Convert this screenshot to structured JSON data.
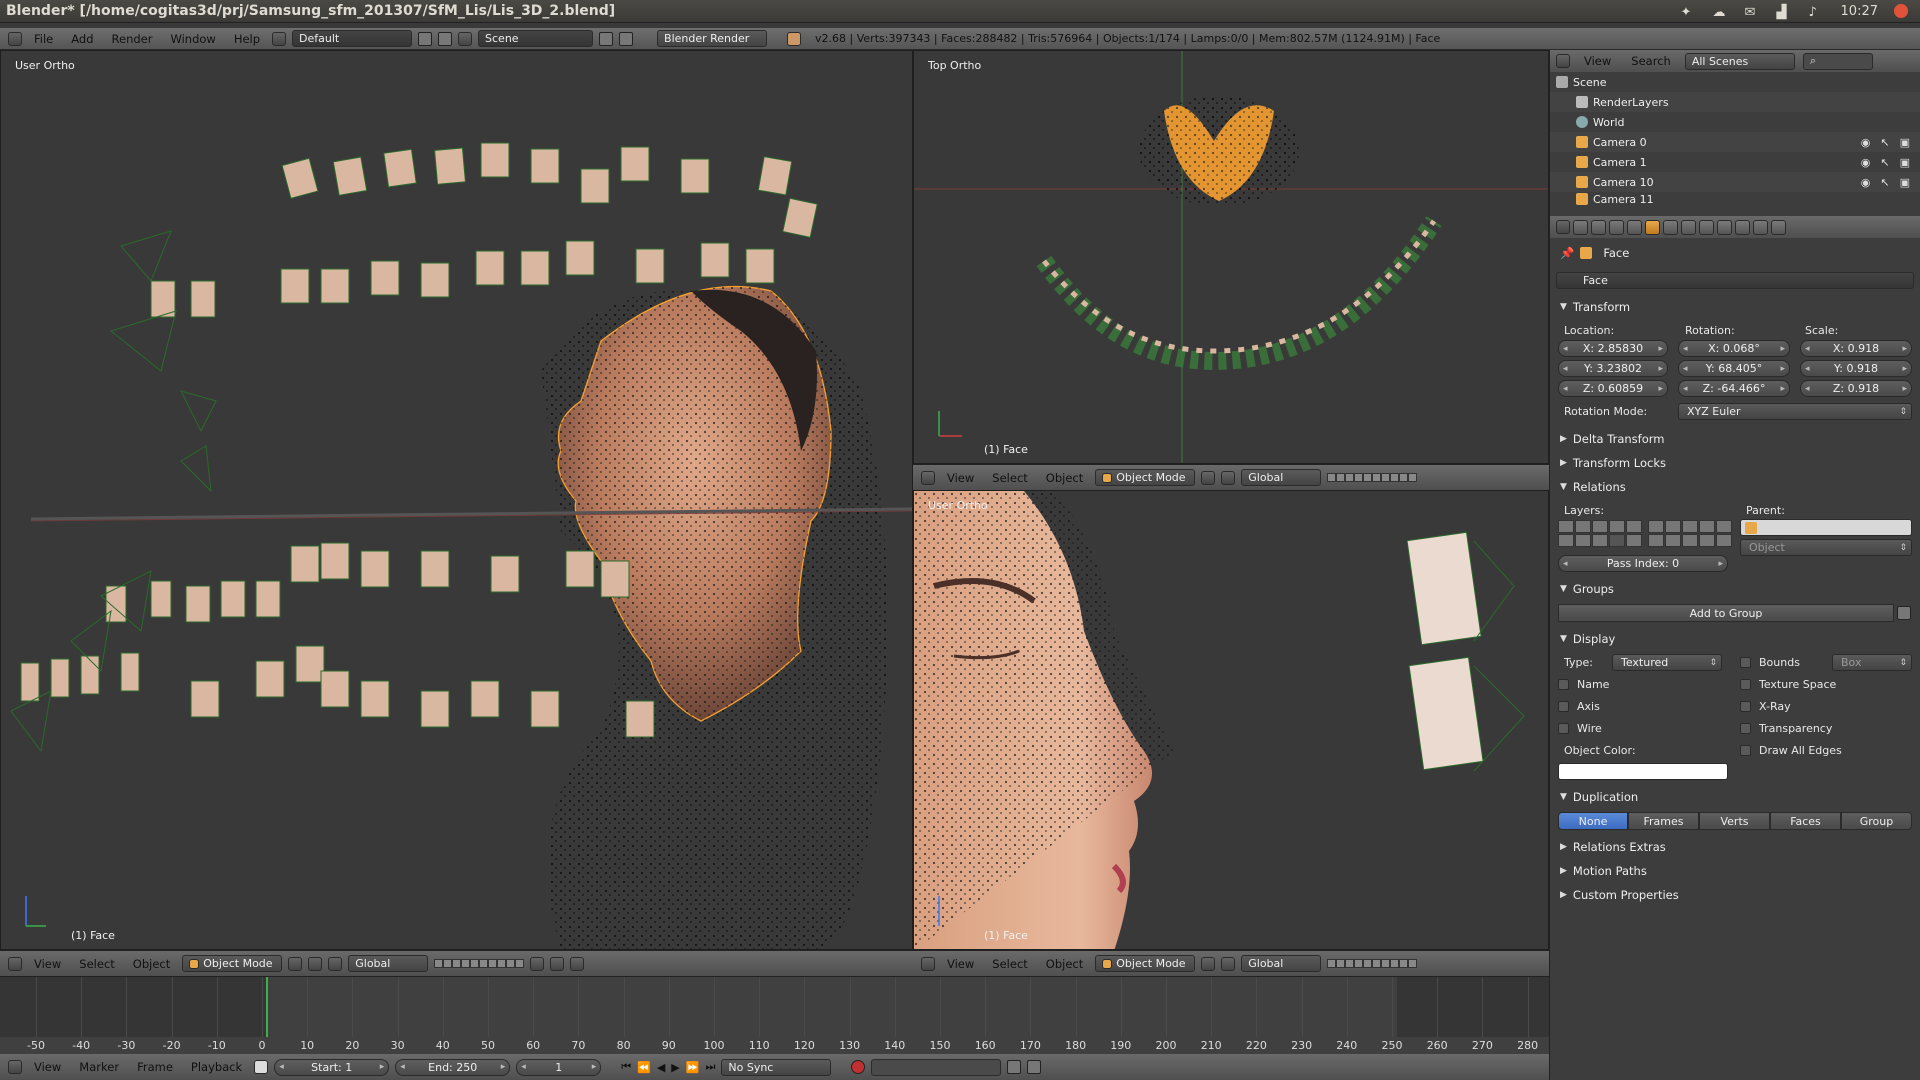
{
  "window": {
    "title": "Blender* [/home/cogitas3d/prj/Samsung_sfm_201307/SfM_Lis/Lis_3D_2.blend]",
    "clock": "10:27"
  },
  "header": {
    "menus": [
      "File",
      "Add",
      "Render",
      "Window",
      "Help"
    ],
    "screen_layout": "Default",
    "scene": "Scene",
    "render_engine": "Blender Render",
    "stats": "v2.68 | Verts:397343 | Faces:288482 | Tris:576964 | Objects:1/174 | Lamps:0/0 | Mem:802.57M (1124.91M) | Face"
  },
  "viewports": {
    "left": {
      "label": "User Ortho",
      "footer": "(1) Face"
    },
    "top_right": {
      "label": "Top Ortho",
      "footer": "(1) Face"
    },
    "bottom_right": {
      "label": "User Ortho",
      "footer": "(1) Face"
    }
  },
  "view_header": {
    "menus": [
      "View",
      "Select",
      "Object"
    ],
    "mode": "Object Mode",
    "orientation": "Global"
  },
  "outliner": {
    "menus": [
      "View",
      "Search"
    ],
    "filter": "All Scenes",
    "rows": [
      "Scene",
      "RenderLayers",
      "World",
      "Camera 0",
      "Camera 1",
      "Camera 10",
      "Camera 11"
    ]
  },
  "properties": {
    "object_name": "Face",
    "breadcrumb": "Face",
    "transform": {
      "title": "Transform",
      "location_label": "Location:",
      "rotation_label": "Rotation:",
      "scale_label": "Scale:",
      "location": [
        "X: 2.85830",
        "Y: 3.23802",
        "Z: 0.60859"
      ],
      "rotation": [
        "X: 0.068°",
        "Y: 68.405°",
        "Z: -64.466°"
      ],
      "scale": [
        "X: 0.918",
        "Y: 0.918",
        "Z: 0.918"
      ],
      "rotation_mode_label": "Rotation Mode:",
      "rotation_mode": "XYZ Euler"
    },
    "delta_transform": "Delta Transform",
    "transform_locks": "Transform Locks",
    "relations": {
      "title": "Relations",
      "layers_label": "Layers:",
      "parent_label": "Parent:",
      "parent_type": "Object",
      "pass_index": "Pass Index: 0"
    },
    "groups": {
      "title": "Groups",
      "add_button": "Add to Group"
    },
    "display": {
      "title": "Display",
      "type_label": "Type:",
      "type_value": "Textured",
      "bounds": "Bounds",
      "bounds_type": "Box",
      "name": "Name",
      "texture_space": "Texture Space",
      "axis": "Axis",
      "xray": "X-Ray",
      "wire": "Wire",
      "transparency": "Transparency",
      "draw_all_edges": "Draw All Edges",
      "object_color_label": "Object Color:",
      "object_color": "#ffffff"
    },
    "duplication": {
      "title": "Duplication",
      "options": [
        "None",
        "Frames",
        "Verts",
        "Faces",
        "Group"
      ],
      "active": "None"
    },
    "relations_extras": "Relations Extras",
    "motion_paths": "Motion Paths",
    "custom_properties": "Custom Properties"
  },
  "timeline": {
    "ticks": [
      "-50",
      "-40",
      "-30",
      "-20",
      "-10",
      "0",
      "10",
      "20",
      "30",
      "40",
      "50",
      "60",
      "70",
      "80",
      "90",
      "100",
      "110",
      "120",
      "130",
      "140",
      "150",
      "160",
      "170",
      "180",
      "190",
      "200",
      "210",
      "220",
      "230",
      "240",
      "250",
      "260",
      "270",
      "280"
    ],
    "menus": [
      "View",
      "Marker",
      "Frame",
      "Playback"
    ],
    "start": "Start: 1",
    "end": "End: 250",
    "current": "1",
    "sync": "No Sync"
  },
  "colors": {
    "selection_orange": "#f5a030",
    "camera_green": "#2a6a2a",
    "active_blue": "#4a7ad0"
  }
}
